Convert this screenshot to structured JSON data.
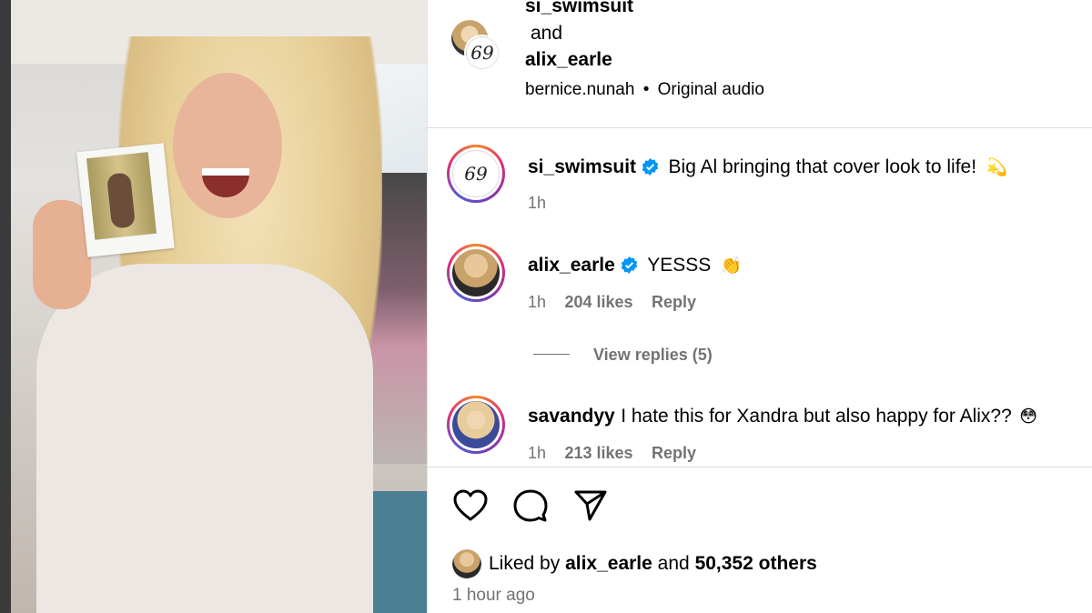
{
  "header": {
    "account1": "si_swimsuit",
    "joiner": "and",
    "account2": "alix_earle",
    "audio_user": "bernice.nunah",
    "separator": "•",
    "audio_label": "Original audio"
  },
  "comments": [
    {
      "username": "si_swimsuit",
      "verified": true,
      "text": "Big Al bringing that cover look to life!",
      "emoji": "💫",
      "time": "1h"
    },
    {
      "username": "alix_earle",
      "verified": true,
      "text": "YESSS",
      "emoji": "👏",
      "time": "1h",
      "likes": "204 likes",
      "reply_label": "Reply",
      "view_replies": "View replies (5)"
    },
    {
      "username": "savandyy",
      "verified": false,
      "text": "I hate this for Xandra but also happy for Alix??",
      "emoji": "😳",
      "time": "1h",
      "likes": "213 likes",
      "reply_label": "Reply"
    }
  ],
  "footer": {
    "liked_prefix": "Liked by",
    "liked_user": "alix_earle",
    "liked_and": "and",
    "liked_others": "50,352 others",
    "posted_time": "1 hour ago"
  },
  "icons": [
    "heart-icon",
    "comment-icon",
    "share-icon",
    "verified-icon"
  ],
  "colors": {
    "verified_blue": "#0095f6",
    "meta_gray": "#737373",
    "divider": "#dbdbdb"
  }
}
